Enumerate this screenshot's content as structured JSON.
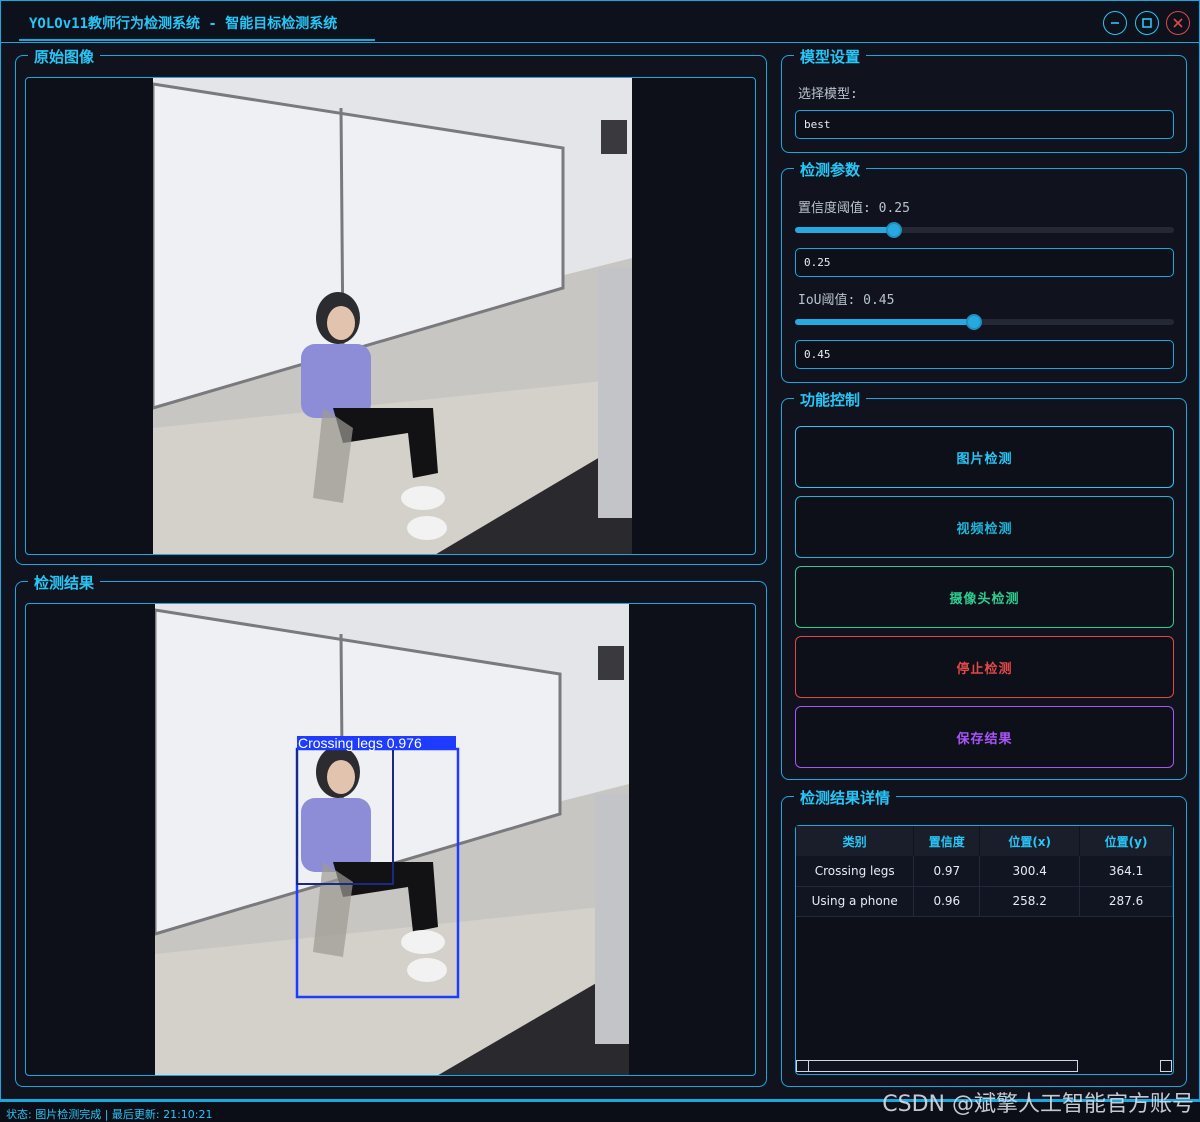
{
  "window": {
    "title": "YOLOv11教师行为检测系统 - 智能目标检测系统"
  },
  "original": {
    "title": "原始图像"
  },
  "result": {
    "title": "检测结果",
    "boxes": [
      {
        "label": "Crossing legs 0.976"
      }
    ]
  },
  "model": {
    "title": "模型设置",
    "select_label": "选择模型:",
    "selected": "best"
  },
  "params": {
    "title": "检测参数",
    "conf_label": "置信度阈值: 0.25",
    "conf_value": "0.25",
    "conf_level": 0.25,
    "iou_label": "IoU阈值: 0.45",
    "iou_value": "0.45",
    "iou_level": 0.45
  },
  "controls": {
    "title": "功能控制",
    "buttons": [
      {
        "label": "图片检测",
        "color": "#27c6f6"
      },
      {
        "label": "视频检测",
        "color": "#1fb5d8"
      },
      {
        "label": "摄像头检测",
        "color": "#2ecc8f"
      },
      {
        "label": "停止检测",
        "color": "#e04848"
      },
      {
        "label": "保存结果",
        "color": "#a855f7"
      }
    ]
  },
  "details": {
    "title": "检测结果详情",
    "columns": [
      "类别",
      "置信度",
      "位置(x)",
      "位置(y)"
    ],
    "rows": [
      [
        "Crossing legs",
        "0.97",
        "300.4",
        "364.1"
      ],
      [
        "Using a phone",
        "0.96",
        "258.2",
        "287.6"
      ]
    ]
  },
  "status": {
    "text": "状态: 图片检测完成 | 最后更新: 21:10:21"
  },
  "watermark": {
    "text": "CSDN @斌擎人工智能官方账号"
  },
  "colors": {
    "accent": "#18a8e0",
    "box": "#1e3cff"
  }
}
